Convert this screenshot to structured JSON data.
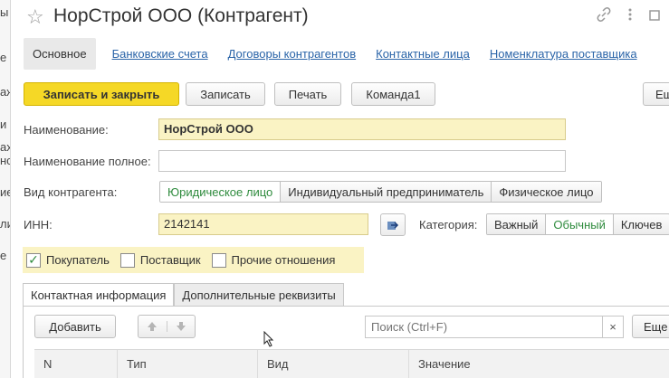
{
  "left_strip": [
    "ы",
    "е",
    "аж",
    "и",
    "ах",
    "нсы",
    "ие",
    "ли",
    "е"
  ],
  "title": {
    "star": "☆",
    "text": "НорСтрой ООО (Контрагент)"
  },
  "title_icons": {
    "link": "link-icon",
    "more": "more-icon",
    "maximize": "maximize-icon"
  },
  "nav": [
    {
      "label": "Основное"
    },
    {
      "label": "Банковские счета"
    },
    {
      "label": "Договоры контрагентов"
    },
    {
      "label": "Контактные лица"
    },
    {
      "label": "Номенклатура поставщика"
    }
  ],
  "toolbar": {
    "save_close": "Записать и закрыть",
    "save": "Записать",
    "print": "Печать",
    "command1": "Команда1",
    "more": "Ещ"
  },
  "form": {
    "name_label": "Наименование:",
    "name_value": "НорСтрой ООО",
    "full_name_label": "Наименование полное:",
    "full_name_value": "",
    "type_label": "Вид контрагента:",
    "type_options": [
      "Юридическое лицо",
      "Индивидуальный предприниматель",
      "Физическое лицо"
    ],
    "inn_label": "ИНН:",
    "inn_value": "2142141",
    "category_label": "Категория:",
    "category_options": [
      "Важный",
      "Обычный",
      "Ключев"
    ],
    "checks": [
      {
        "label": "Покупатель",
        "checked": true
      },
      {
        "label": "Поставщик",
        "checked": false
      },
      {
        "label": "Прочие отношения",
        "checked": false
      }
    ]
  },
  "tabs": [
    "Контактная информация",
    "Дополнительные реквизиты"
  ],
  "table_toolbar": {
    "add": "Добавить",
    "search_placeholder": "Поиск (Ctrl+F)",
    "clear": "×",
    "more": "Еще"
  },
  "table_columns": [
    "N",
    "Тип",
    "Вид",
    "Значение"
  ],
  "colors": {
    "accent_yellow": "#f5d826",
    "field_yellow": "#faf3c4",
    "link_blue": "#2a64a8",
    "selected_green": "#2e8b3d"
  }
}
